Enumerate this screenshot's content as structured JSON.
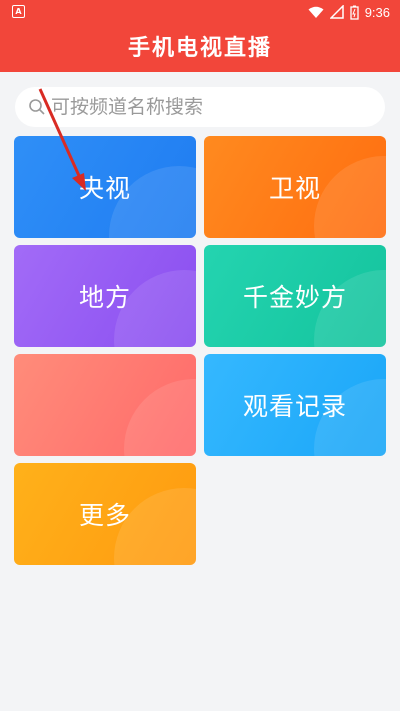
{
  "status": {
    "time": "9:36",
    "left_icon": "a-icon"
  },
  "app": {
    "title": "手机电视直播"
  },
  "search": {
    "placeholder": "可按频道名称搜索"
  },
  "tiles": [
    {
      "label": "央视"
    },
    {
      "label": "卫视"
    },
    {
      "label": "地方"
    },
    {
      "label": "千金妙方"
    },
    {
      "label": ""
    },
    {
      "label": "观看记录"
    },
    {
      "label": "更多"
    }
  ],
  "colors": {
    "primary": "#f2463a"
  }
}
